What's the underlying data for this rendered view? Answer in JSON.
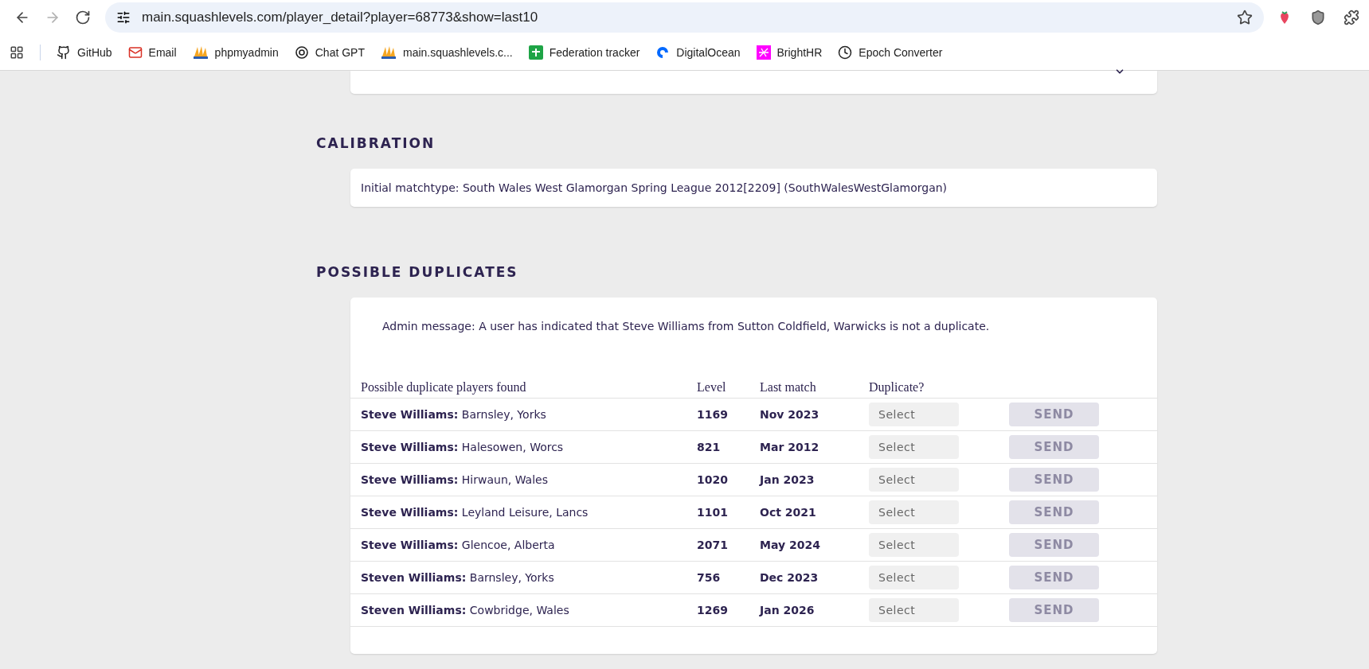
{
  "browser": {
    "nav": [
      {
        "kind": "back",
        "disabled": false
      },
      {
        "kind": "forward",
        "disabled": true
      },
      {
        "kind": "reload",
        "disabled": false
      }
    ],
    "url": "main.squashlevels.com/player_detail?player=68773&show=last10"
  },
  "bookmarks": [
    {
      "label": "GitHub"
    },
    {
      "label": "Email"
    },
    {
      "label": "phpmyadmin"
    },
    {
      "label": "Chat GPT"
    },
    {
      "label": "main.squashlevels.c..."
    },
    {
      "label": "Federation tracker"
    },
    {
      "label": "DigitalOcean"
    },
    {
      "label": "BrightHR"
    },
    {
      "label": "Epoch Converter"
    }
  ],
  "calibration": {
    "heading": "CALIBRATION",
    "text": "Initial matchtype: South Wales West Glamorgan Spring League 2012[2209] (SouthWalesWestGlamorgan)"
  },
  "duplicates": {
    "heading": "POSSIBLE DUPLICATES",
    "message": "Admin message: A user has indicated that Steve Williams from Sutton Coldfield, Warwicks is not a duplicate.",
    "columns": [
      "Possible duplicate players found",
      "Level",
      "Last match",
      "Duplicate?"
    ],
    "rows": [
      {
        "player": "**Steve Williams:** Barnsley, Yorks",
        "level": "1169",
        "last_match": "Nov 2023",
        "select": "Select",
        "send": "SEND",
        "send_disabled": true
      },
      {
        "player": "**Steve Williams:** Halesowen, Worcs",
        "level": "821",
        "last_match": "Mar 2012",
        "select": "Select",
        "send": "SEND",
        "send_disabled": true
      },
      {
        "player": "**Steve Williams:** Hirwaun, Wales",
        "level": "1020",
        "last_match": "Jan 2023",
        "select": "Select",
        "send": "SEND",
        "send_disabled": true
      },
      {
        "player": "**Steve Williams:** Leyland Leisure, Lancs",
        "level": "1101",
        "last_match": "Oct 2021",
        "select": "Select",
        "send": "SEND",
        "send_disabled": true
      },
      {
        "player": "**Steve Williams:** Glencoe, Alberta",
        "level": "2071",
        "last_match": "May 2024",
        "select": "Select",
        "send": "SEND",
        "send_disabled": true
      },
      {
        "player": "**Steven Williams:** Barnsley, Yorks",
        "level": "756",
        "last_match": "Dec 2023",
        "select": "Select",
        "send": "SEND",
        "send_disabled": true
      },
      {
        "player": "**Steven Williams:** Cowbridge, Wales",
        "level": "1269",
        "last_match": "Jan 2026",
        "select": "Select",
        "send": "SEND",
        "send_disabled": true
      }
    ]
  }
}
